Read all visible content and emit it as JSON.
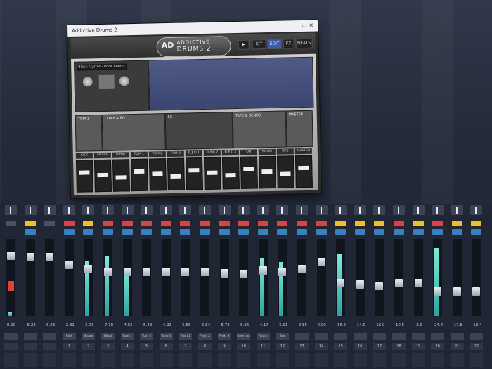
{
  "plugin": {
    "window_title": "Addictive Drums 2",
    "logo": {
      "mark": "AD",
      "line1": "ADDICTIVE",
      "line2": "DRUMS 2"
    },
    "top_buttons": [
      "KIT",
      "EDIT",
      "FX",
      "BEATS"
    ],
    "preset": "Black Oyster - Rock Room",
    "fx_sections": [
      "TOM 1",
      "COMP & EQ",
      "FX",
      "TAPE & SENDS",
      "MASTER"
    ],
    "channel_names": [
      "KICK",
      "SNARE",
      "HIHAT",
      "TOM 1",
      "TOM 2",
      "TOM 3",
      "FLEXI 1",
      "FLEXI 2",
      "FLEXI 3",
      "OH",
      "ROOM",
      "BUS",
      "MASTER"
    ]
  },
  "mixer": {
    "strips": [
      {
        "value": "0.00",
        "name": "",
        "number": "",
        "level": 0.05,
        "fader": 0.82,
        "rec": "gray",
        "mon": "none"
      },
      {
        "value": "-6.22",
        "name": "",
        "number": "",
        "level": 0.0,
        "fader": 0.8,
        "rec": "yellow",
        "mon": "blue"
      },
      {
        "value": "-6.23",
        "name": "",
        "number": "",
        "level": 0.0,
        "fader": 0.8,
        "rec": "gray",
        "mon": "none"
      },
      {
        "value": "-2.81",
        "name": "Kick",
        "number": "1",
        "level": 0.0,
        "fader": 0.68,
        "rec": "red",
        "mon": "blue"
      },
      {
        "value": "-5.73",
        "name": "Snare",
        "number": "2",
        "level": 0.72,
        "fader": 0.62,
        "rec": "yellow",
        "mon": "blue"
      },
      {
        "value": "-7.10",
        "name": "Hihat",
        "number": "3",
        "level": 0.78,
        "fader": 0.58,
        "rec": "red",
        "mon": "blue"
      },
      {
        "value": "-4.65",
        "name": "Tom 1",
        "number": "4",
        "level": 0.62,
        "fader": 0.58,
        "rec": "red",
        "mon": "blue"
      },
      {
        "value": "-5.48",
        "name": "Tom 2",
        "number": "5",
        "level": 0.0,
        "fader": 0.58,
        "rec": "red",
        "mon": "blue"
      },
      {
        "value": "-4.22",
        "name": "Tom 3",
        "number": "6",
        "level": 0.0,
        "fader": 0.58,
        "rec": "red",
        "mon": "blue"
      },
      {
        "value": "-5.55",
        "name": "Flexi 1",
        "number": "7",
        "level": 0.0,
        "fader": 0.58,
        "rec": "red",
        "mon": "blue"
      },
      {
        "value": "-5.84",
        "name": "Flexi 2",
        "number": "8",
        "level": 0.0,
        "fader": 0.58,
        "rec": "red",
        "mon": "blue"
      },
      {
        "value": "-5.72",
        "name": "Flexi 3",
        "number": "9",
        "level": 0.0,
        "fader": 0.56,
        "rec": "red",
        "mon": "blue"
      },
      {
        "value": "-6.36",
        "name": "Overhead",
        "number": "10",
        "level": 0.0,
        "fader": 0.55,
        "rec": "red",
        "mon": "blue"
      },
      {
        "value": "-4.17",
        "name": "Room",
        "number": "11",
        "level": 0.75,
        "fader": 0.6,
        "rec": "red",
        "mon": "blue"
      },
      {
        "value": "-5.91",
        "name": "Bus",
        "number": "12",
        "level": 0.7,
        "fader": 0.58,
        "rec": "red",
        "mon": "blue"
      },
      {
        "value": "-2.85",
        "name": "",
        "number": "13",
        "level": 0.0,
        "fader": 0.62,
        "rec": "red",
        "mon": "blue"
      },
      {
        "value": "0.00",
        "name": "",
        "number": "14",
        "level": 0.0,
        "fader": 0.72,
        "rec": "red",
        "mon": "blue"
      },
      {
        "value": "-16.5",
        "name": "",
        "number": "15",
        "level": 0.8,
        "fader": 0.42,
        "rec": "yellow",
        "mon": "blue"
      },
      {
        "value": "-14.0",
        "name": "",
        "number": "16",
        "level": 0.0,
        "fader": 0.4,
        "rec": "yellow",
        "mon": "blue"
      },
      {
        "value": "-16.9",
        "name": "",
        "number": "17",
        "level": 0.0,
        "fader": 0.38,
        "rec": "yellow",
        "mon": "blue"
      },
      {
        "value": "-10.5",
        "name": "",
        "number": "18",
        "level": 0.0,
        "fader": 0.42,
        "rec": "red",
        "mon": "blue"
      },
      {
        "value": "-2.9",
        "name": "",
        "number": "19",
        "level": 0.0,
        "fader": 0.42,
        "rec": "yellow",
        "mon": "blue"
      },
      {
        "value": "-24.4",
        "name": "",
        "number": "20",
        "level": 0.88,
        "fader": 0.3,
        "rec": "red",
        "mon": "blue"
      },
      {
        "value": "-17.8",
        "name": "",
        "number": "21",
        "level": 0.0,
        "fader": 0.3,
        "rec": "yellow",
        "mon": "blue"
      },
      {
        "value": "-18.4",
        "name": "",
        "number": "22",
        "level": 0.0,
        "fader": 0.3,
        "rec": "yellow",
        "mon": "blue"
      }
    ]
  },
  "colors": {
    "red": "#e04040",
    "yellow": "#f0c020",
    "blue": "#3c7fbd",
    "gray": "#475269",
    "meter": "#5fd3c6"
  }
}
